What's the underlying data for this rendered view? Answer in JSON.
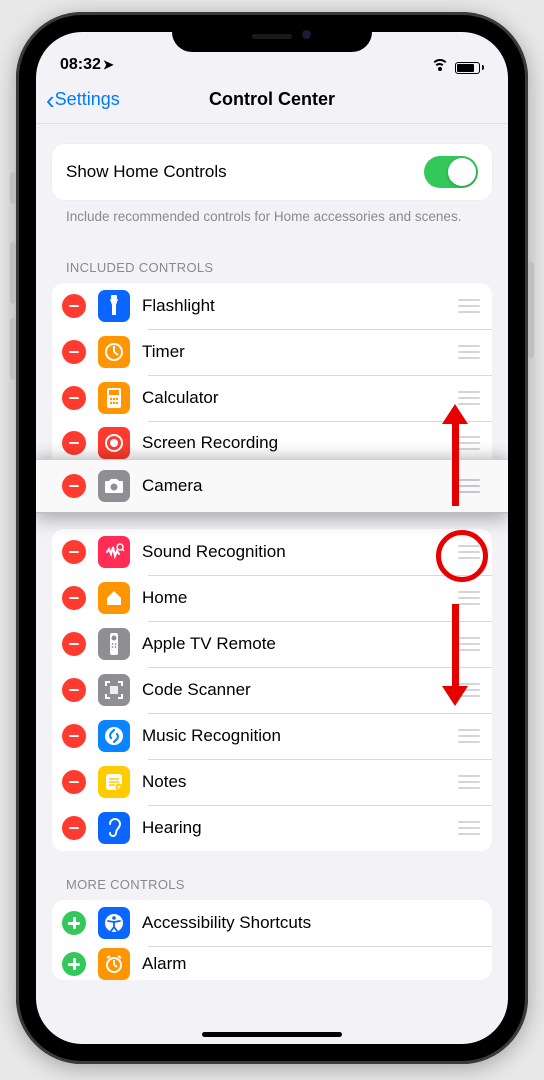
{
  "status": {
    "time": "08:32",
    "loc": "➤"
  },
  "nav": {
    "back": "Settings",
    "title": "Control Center"
  },
  "home": {
    "label": "Show Home Controls",
    "hint": "Include recommended controls for Home accessories and scenes."
  },
  "sections": {
    "included_header": "INCLUDED CONTROLS",
    "more_header": "MORE CONTROLS"
  },
  "included": [
    {
      "label": "Flashlight",
      "icon": "flashlight",
      "bg": "#0a66ff"
    },
    {
      "label": "Timer",
      "icon": "timer",
      "bg": "#ff9500"
    },
    {
      "label": "Calculator",
      "icon": "calculator",
      "bg": "#ff9500"
    },
    {
      "label": "Screen Recording",
      "icon": "record",
      "bg": "#ff3b30"
    },
    {
      "label": "Camera",
      "icon": "camera",
      "bg": "#8e8e93",
      "lifted": true
    },
    {
      "label": "Sound Recognition",
      "icon": "sound",
      "bg": "#ff2d55"
    },
    {
      "label": "Home",
      "icon": "home",
      "bg": "#ff9500"
    },
    {
      "label": "Apple TV Remote",
      "icon": "remote",
      "bg": "#8e8e93"
    },
    {
      "label": "Code Scanner",
      "icon": "qr",
      "bg": "#8e8e93"
    },
    {
      "label": "Music Recognition",
      "icon": "shazam",
      "bg": "#0a84ff"
    },
    {
      "label": "Notes",
      "icon": "notes",
      "bg": "#ffcc00"
    },
    {
      "label": "Hearing",
      "icon": "ear",
      "bg": "#0a66ff"
    }
  ],
  "more": [
    {
      "label": "Accessibility Shortcuts",
      "icon": "access",
      "bg": "#0a66ff"
    },
    {
      "label": "Alarm",
      "icon": "alarm",
      "bg": "#ff9500"
    }
  ],
  "colors": {
    "accent": "#007aff",
    "remove": "#ff3b30",
    "add": "#34c759",
    "annotation": "#e60000"
  }
}
